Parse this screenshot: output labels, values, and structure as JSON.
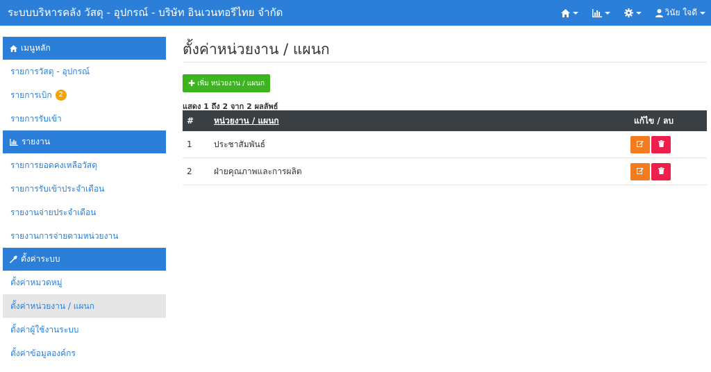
{
  "navbar": {
    "brand": "ระบบบริหารคลัง วัสดุ - อุปกรณ์  -  บริษัท อินเวนทอรีไทย จำกัด",
    "user_name": "วินัย ใจดี",
    "icons": [
      "home-icon",
      "bar-chart-icon",
      "gear-icon",
      "user-icon"
    ]
  },
  "sidebar": {
    "sections": [
      {
        "header": "เมนูหลัก",
        "icon": "home-icon",
        "items": [
          {
            "label": "รายการวัสดุ - อุปกรณ์"
          },
          {
            "label": "รายการเบิก",
            "badge": "2"
          },
          {
            "label": "รายการรับเข้า"
          }
        ]
      },
      {
        "header": "รายงาน",
        "icon": "bar-chart-icon",
        "items": [
          {
            "label": "รายการยอดคงเหลือวัสดุ"
          },
          {
            "label": "รายการรับเข้าประจำเดือน"
          },
          {
            "label": "รายงานจ่ายประจำเดือน"
          },
          {
            "label": "รายงานการจ่ายตามหน่วยงาน"
          }
        ]
      },
      {
        "header": "ตั้งค่าระบบ",
        "icon": "wrench-icon",
        "items": [
          {
            "label": "ตั้งค่าหมวดหมู่"
          },
          {
            "label": "ตั้งค่าหน่วยงาน / แผนก",
            "active": true
          },
          {
            "label": "ตั้งค่าผู้ใช้งานระบบ"
          },
          {
            "label": "ตั้งค่าข้อมูลองค์กร"
          }
        ]
      }
    ]
  },
  "main": {
    "title": "ตั้งค่าหน่วยงาน / แผนก",
    "add_button": "เพิ่ม หน่วยงาน / แผนก",
    "result_count": "แสดง 1 ถึง 2 จาก 2 ผลลัพธ์",
    "table": {
      "headers": [
        "#",
        "หน่วยงาน / แผนก",
        "แก้ไข / ลบ"
      ],
      "rows": [
        {
          "num": "1",
          "name": "ประชาสัมพันธ์"
        },
        {
          "num": "2",
          "name": "ฝ่ายคุณภาพและการผลิต"
        }
      ]
    }
  },
  "colors": {
    "primary": "#2b7fd8",
    "success": "#3cb521",
    "warning": "#f47c20",
    "danger": "#ee1f4b",
    "table_header": "#3a3f44",
    "badge": "#f0a30a"
  }
}
